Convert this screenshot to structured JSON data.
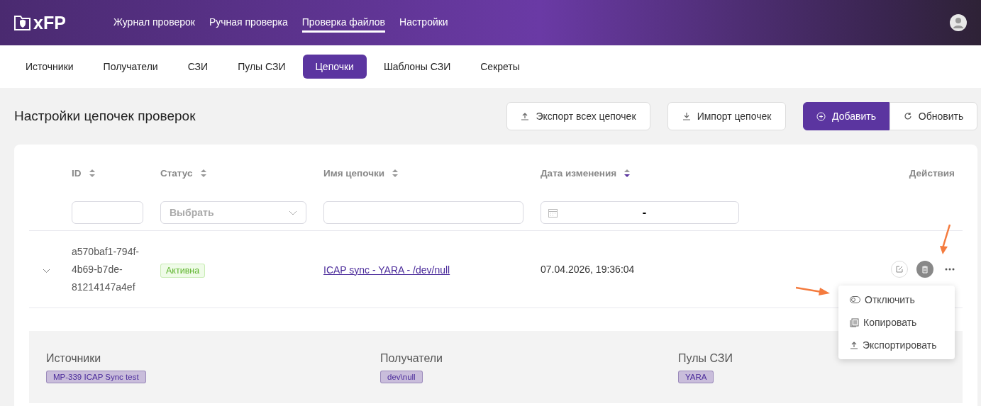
{
  "header": {
    "logo": "xFP",
    "nav": [
      {
        "label": "Журнал проверок",
        "selected": false
      },
      {
        "label": "Ручная проверка",
        "selected": false
      },
      {
        "label": "Проверка файлов",
        "selected": true
      },
      {
        "label": "Настройки",
        "selected": false
      }
    ]
  },
  "subnav": [
    {
      "label": "Источники",
      "selected": false
    },
    {
      "label": "Получатели",
      "selected": false
    },
    {
      "label": "СЗИ",
      "selected": false
    },
    {
      "label": "Пулы СЗИ",
      "selected": false
    },
    {
      "label": "Цепочки",
      "selected": true
    },
    {
      "label": "Шаблоны СЗИ",
      "selected": false
    },
    {
      "label": "Секреты",
      "selected": false
    }
  ],
  "page_title": "Настройки цепочек проверок",
  "toolbar": [
    {
      "label": "Экспорт всех цепочек",
      "kind": "export"
    },
    {
      "label": "Импорт цепочек",
      "kind": "import"
    },
    {
      "label": "Добавить",
      "kind": "add"
    },
    {
      "label": "Обновить",
      "kind": "refresh"
    }
  ],
  "table": {
    "columns": [
      {
        "label": "ID",
        "sorted_desc": false,
        "kind": "text"
      },
      {
        "label": "Статус",
        "sorted_desc": false,
        "kind": "select",
        "placeholder": "Выбрать"
      },
      {
        "label": "Имя цепочки",
        "sorted_desc": false,
        "kind": "text"
      },
      {
        "label": "Дата изменения",
        "sorted_desc": true,
        "kind": "date",
        "value": "-"
      },
      {
        "label": "Действия",
        "kind": "actions"
      }
    ],
    "rows": [
      {
        "expanded": true,
        "id": "a570baf1-794f-4b69-b7de-81214147a4ef",
        "status": "Активна",
        "name": "ICAP sync - YARA - /dev/null",
        "date": "07.04.2026, 19:36:04",
        "details": [
          {
            "label": "Источники",
            "tags": [
              "MP-339 ICAP Sync test"
            ]
          },
          {
            "label": "Получатели",
            "tags": [
              "dev\\null"
            ]
          },
          {
            "label": "Пулы СЗИ",
            "tags": [
              "YARA"
            ]
          }
        ]
      }
    ]
  },
  "menu": [
    {
      "label": "Отключить",
      "kind": "toggle"
    },
    {
      "label": "Копировать",
      "kind": "copy"
    },
    {
      "label": "Экспортировать",
      "kind": "export"
    }
  ]
}
